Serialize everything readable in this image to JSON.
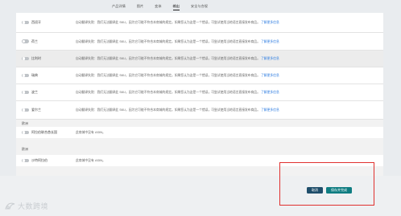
{
  "tabs": [
    {
      "label": "产品详情",
      "active": false
    },
    {
      "label": "图片",
      "active": false
    },
    {
      "label": "变体",
      "active": false
    },
    {
      "label": "输出",
      "active": true
    },
    {
      "label": "安全与合规",
      "active": false
    }
  ],
  "marketplace_rows": [
    {
      "name": "西班牙",
      "message": "自动翻译失败：我们无法翻译此 SKU，因为它可能不符合本商城的规定。如果您认为这是一个错误，可尝试使用当地语言直接发布商品。",
      "link": "了解更多信息"
    },
    {
      "name": "荷兰",
      "message": "自动翻译失败：我们无法翻译此 SKU，因为它可能不符合本商城的规定。如果您认为这是一个错误，可尝试使用当地语言直接发布商品。",
      "link": "了解更多信息"
    },
    {
      "name": "比利时",
      "message": "自动翻译失败：我们无法翻译此 SKU，因为它可能不符合本商城的规定。如果您认为这是一个错误，可尝试使用当地语言直接发布商品。",
      "link": "了解更多信息"
    },
    {
      "name": "瑞典",
      "message": "自动翻译失败：我们无法翻译此 SKU，因为它可能不符合本商城的规定。如果您认为这是一个错误，可尝试使用当地语言直接发布商品。",
      "link": "了解更多信息"
    },
    {
      "name": "波兰",
      "message": "自动翻译失败：我们无法翻译此 SKU，因为它可能不符合本商城的规定。如果您认为这是一个错误，可尝试使用当地语言直接发布商品。",
      "link": "了解更多信息"
    },
    {
      "name": "爱尔兰",
      "message": "自动翻译失败：我们无法翻译此 SKU，因为它可能不符合本商城的规定。如果您认为这是一个错误，可尝试使用当地语言直接发布商品。",
      "link": "了解更多信息"
    }
  ],
  "sections": [
    {
      "label": "欧洲",
      "row_name": "阿拉伯联合酋长国",
      "row_message": "此商城中没有 ASIN。"
    },
    {
      "label": "欧洲",
      "row_name": "沙特阿拉伯",
      "row_message": "此商城中没有 ASIN。"
    }
  ],
  "footer": {
    "cancel_label": "取消",
    "save_label": "保存并完成"
  },
  "watermark": {
    "text": "大数跨境"
  },
  "colors": {
    "save_button": "#0f7d82",
    "cancel_button": "#1f4e6b",
    "link": "#2f7de1",
    "highlight": "#e0302e"
  }
}
